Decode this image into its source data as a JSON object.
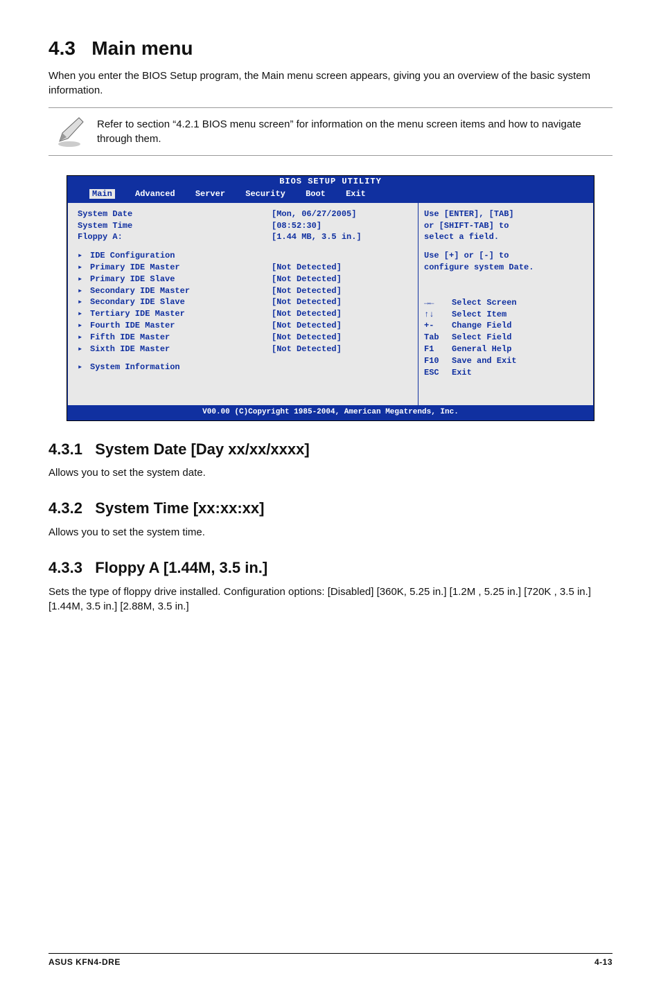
{
  "title": {
    "num": "4.3",
    "text": "Main menu"
  },
  "intro": "When you enter the BIOS Setup program, the Main menu screen appears, giving you an overview of the basic system information.",
  "note": "Refer to section “4.2.1  BIOS menu screen” for information on the menu screen items and how to navigate through them.",
  "bios": {
    "title": "BIOS SETUP UTILITY",
    "tabs": [
      "Main",
      "Advanced",
      "Server",
      "Security",
      "Boot",
      "Exit"
    ],
    "selected_tab": "Main",
    "fields": [
      {
        "label": "System Date",
        "value": "[Mon, 06/27/2005]"
      },
      {
        "label": "System Time",
        "value": "[08:52:30]"
      },
      {
        "label": "Floppy A:",
        "value": "[1.44 MB, 3.5 in.]"
      }
    ],
    "menus": [
      {
        "label": "IDE Configuration",
        "value": ""
      },
      {
        "label": "Primary IDE Master",
        "value": "[Not Detected]"
      },
      {
        "label": "Primary IDE Slave",
        "value": "[Not Detected]"
      },
      {
        "label": "Secondary IDE Master",
        "value": "[Not Detected]"
      },
      {
        "label": "Secondary IDE Slave",
        "value": "[Not Detected]"
      },
      {
        "label": "Tertiary IDE Master",
        "value": "[Not Detected]"
      },
      {
        "label": "Fourth IDE Master",
        "value": "[Not Detected]"
      },
      {
        "label": "Fifth IDE Master",
        "value": "[Not Detected]"
      },
      {
        "label": "Sixth IDE Master",
        "value": "[Not Detected]"
      }
    ],
    "sysinfo": "System Information",
    "help_top": [
      "Use [ENTER], [TAB]",
      "or [SHIFT-TAB] to",
      "select a field."
    ],
    "help_mid": [
      "Use [+] or [-] to",
      "configure system Date."
    ],
    "nav": [
      {
        "key": "→←",
        "label": "Select Screen"
      },
      {
        "key": "↑↓",
        "label": "Select Item"
      },
      {
        "key": "+-",
        "label": "Change Field"
      },
      {
        "key": "Tab",
        "label": "Select Field"
      },
      {
        "key": "F1",
        "label": "General Help"
      },
      {
        "key": "F10",
        "label": "Save and Exit"
      },
      {
        "key": "ESC",
        "label": "Exit"
      }
    ],
    "footer": "V00.00 (C)Copyright 1985-2004, American Megatrends, Inc."
  },
  "sections": [
    {
      "num": "4.3.1",
      "heading": "System Date [Day xx/xx/xxxx]",
      "body": "Allows you to set the system date."
    },
    {
      "num": "4.3.2",
      "heading": "System Time [xx:xx:xx]",
      "body": "Allows you to set the system time."
    },
    {
      "num": "4.3.3",
      "heading": "Floppy A [1.44M, 3.5 in.]",
      "body": "Sets the type of floppy drive installed. Configuration options: [Disabled] [360K, 5.25 in.] [1.2M , 5.25 in.] [720K , 3.5 in.] [1.44M, 3.5 in.] [2.88M, 3.5 in.]"
    }
  ],
  "footer": {
    "left": "ASUS KFN4-DRE",
    "right": "4-13"
  }
}
